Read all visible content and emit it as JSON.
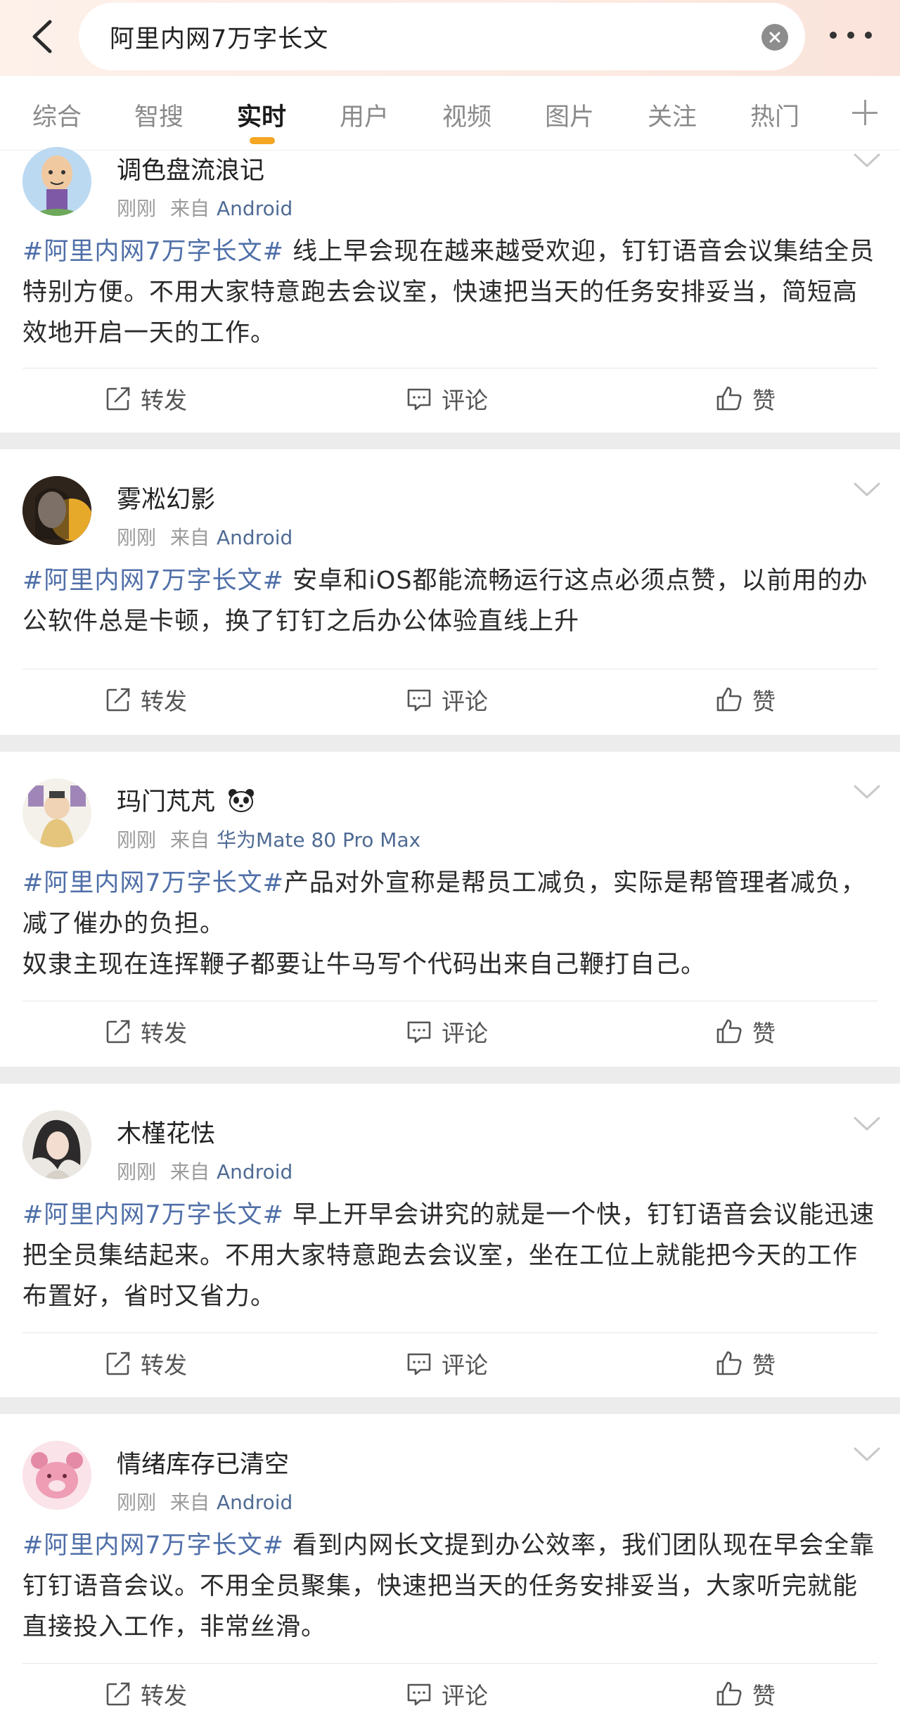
{
  "search": {
    "query": "阿里内网7万字长文"
  },
  "tabs": [
    {
      "label": "综合",
      "active": false
    },
    {
      "label": "智搜",
      "active": false
    },
    {
      "label": "实时",
      "active": true
    },
    {
      "label": "用户",
      "active": false
    },
    {
      "label": "视频",
      "active": false
    },
    {
      "label": "图片",
      "active": false
    },
    {
      "label": "关注",
      "active": false
    },
    {
      "label": "热门",
      "active": false
    }
  ],
  "accent_color": "#f5a623",
  "topic_color": "#4f6fa8",
  "actions": {
    "repost": "转发",
    "comment": "评论",
    "like": "赞"
  },
  "posts": [
    {
      "username": "调色盘流浪记",
      "time": "刚刚",
      "from": "来自",
      "source": "Android",
      "topic": "#阿里内网7万字长文#",
      "lines": [
        "线上早会现在越来越受欢迎，钉钉语音会议集结全员特别方便。不用大家特意跑去会议室，快速把当天的任务安排妥当，简短高效地开启一天的工作。"
      ]
    },
    {
      "username": "雾凇幻影",
      "time": "刚刚",
      "from": "来自",
      "source": "Android",
      "topic": "#阿里内网7万字长文#",
      "lines": [
        "安卓和iOS都能流畅运行这点必须点赞，以前用的办公软件总是卡顿，换了钉钉之后办公体验直线上升"
      ]
    },
    {
      "username": "玛门芃芃",
      "badge_icon": "panda-emoji",
      "time": "刚刚",
      "from": "来自",
      "source": "华为Mate 80 Pro Max",
      "topic": "#阿里内网7万字长文#",
      "lines": [
        "产品对外宣称是帮员工减负，实际是帮管理者减负，减了催办的负担。",
        "奴隶主现在连挥鞭子都要让牛马写个代码出来自己鞭打自己。"
      ]
    },
    {
      "username": "木槿花怯",
      "time": "刚刚",
      "from": "来自",
      "source": "Android",
      "topic": "#阿里内网7万字长文#",
      "lines": [
        "早上开早会讲究的就是一个快，钉钉语音会议能迅速把全员集结起来。不用大家特意跑去会议室，坐在工位上就能把今天的工作布置好，省时又省力。"
      ]
    },
    {
      "username": "情绪库存已清空",
      "time": "刚刚",
      "from": "来自",
      "source": "Android",
      "topic": "#阿里内网7万字长文#",
      "lines": [
        "看到内网长文提到办公效率，我们团队现在早会全靠钉钉语音会议。不用全员聚集，快速把当天的任务安排妥当，大家听完就能直接投入工作，非常丝滑。"
      ]
    }
  ]
}
